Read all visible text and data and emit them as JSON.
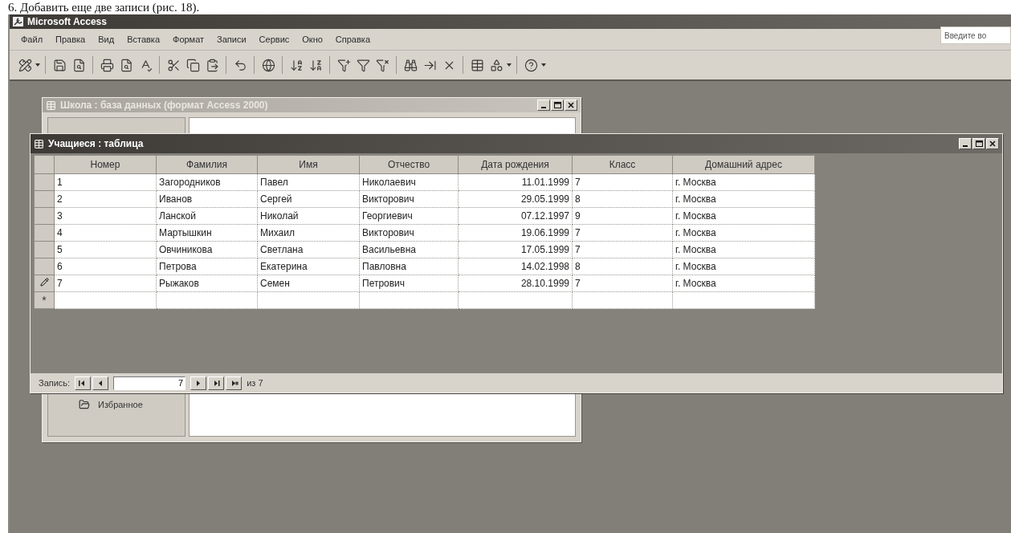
{
  "caption": "6. Добавить еще две записи (рис. 18).",
  "window": {
    "title": "Microsoft Access"
  },
  "menu": [
    "Файл",
    "Правка",
    "Вид",
    "Вставка",
    "Формат",
    "Записи",
    "Сервис",
    "Окно",
    "Справка"
  ],
  "help_search": {
    "placeholder": "Введите во"
  },
  "database_window": {
    "title": "Школа : база данных (формат Access 2000)",
    "active": false,
    "groups": [
      {
        "label": "Избранное"
      }
    ]
  },
  "table_window": {
    "title": "Учащиеся : таблица",
    "active": true,
    "columns": [
      {
        "label": "Номер",
        "kind": "text"
      },
      {
        "label": "Фамилия",
        "kind": "text"
      },
      {
        "label": "Имя",
        "kind": "text"
      },
      {
        "label": "Отчество",
        "kind": "text"
      },
      {
        "label": "Дата рождения",
        "kind": "date"
      },
      {
        "label": "Класс",
        "kind": "text"
      },
      {
        "label": "Домашний адрес",
        "kind": "text"
      }
    ],
    "rows": [
      {
        "editing": false,
        "cells": [
          "1",
          "Загородников",
          "Павел",
          "Николаевич",
          "11.01.1999",
          "7",
          "г. Москва"
        ]
      },
      {
        "editing": false,
        "cells": [
          "2",
          "Иванов",
          "Сергей",
          "Викторович",
          "29.05.1999",
          "8",
          "г. Москва"
        ]
      },
      {
        "editing": false,
        "cells": [
          "3",
          "Ланской",
          "Николай",
          "Георгиевич",
          "07.12.1997",
          "9",
          "г. Москва"
        ]
      },
      {
        "editing": false,
        "cells": [
          "4",
          "Мартышкин",
          "Михаил",
          "Викторович",
          "19.06.1999",
          "7",
          "г. Москва"
        ]
      },
      {
        "editing": false,
        "cells": [
          "5",
          "Овчиникова",
          "Светлана",
          "Васильевна",
          "17.05.1999",
          "7",
          "г. Москва"
        ]
      },
      {
        "editing": false,
        "cells": [
          "6",
          "Петрова",
          "Екатерина",
          "Павловна",
          "14.02.1998",
          "8",
          "г. Москва"
        ]
      },
      {
        "editing": true,
        "cells": [
          "7",
          "Рыжаков",
          "Семен",
          "Петрович",
          "28.10.1999",
          "7",
          "г. Москва"
        ]
      }
    ],
    "new_row": {
      "marker": "*"
    },
    "navigator": {
      "label": "Запись:",
      "current": "7",
      "total": "из 7"
    }
  }
}
